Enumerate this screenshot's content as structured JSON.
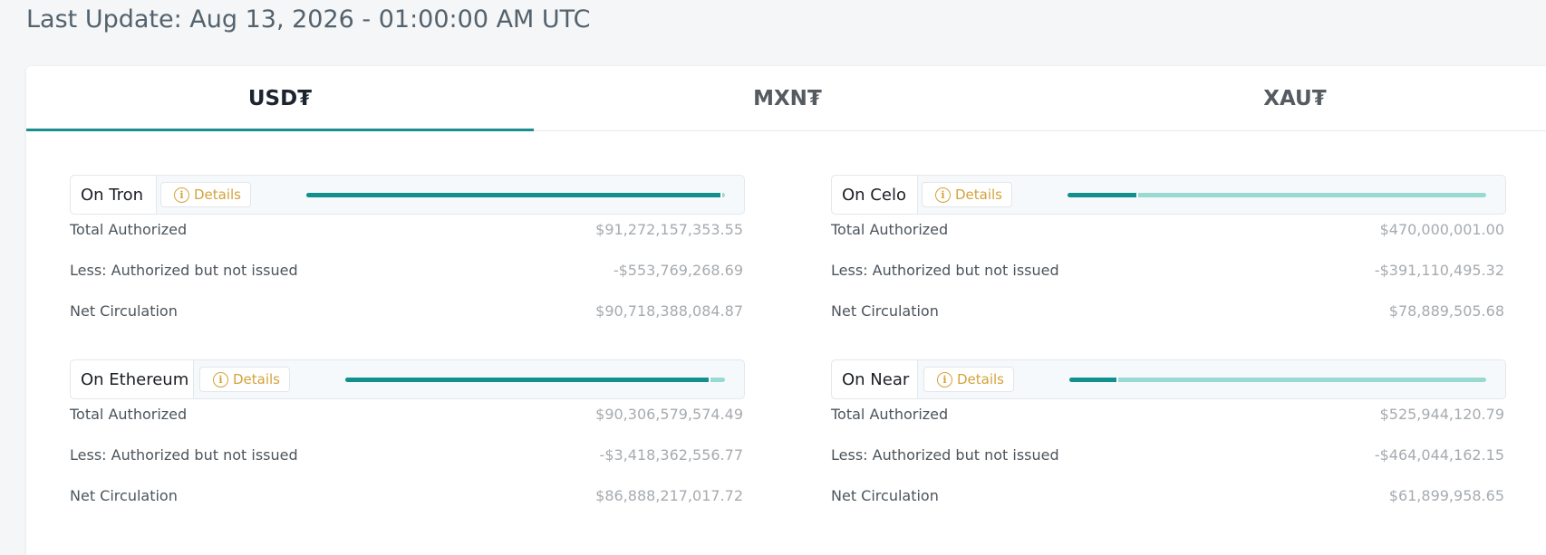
{
  "header": {
    "last_update": "Last Update: Aug 13, 2026 - 01:00:00 AM UTC"
  },
  "tabs": [
    {
      "label": "USD₮",
      "active": true
    },
    {
      "label": "MXN₮",
      "active": false
    },
    {
      "label": "XAU₮",
      "active": false
    }
  ],
  "colors": {
    "accent": "#1a8d8e",
    "bar_fill": "#12908e",
    "bar_track": "#98d9d2",
    "details": "#d4a23a"
  },
  "chains": [
    {
      "name": "On Tron",
      "details_label": "Details",
      "details_icon": "info-icon",
      "issued_fraction": 0.994,
      "rows": [
        {
          "label": "Total Authorized",
          "value": "$91,272,157,353.55"
        },
        {
          "label": "Less: Authorized but not issued",
          "value": "-$553,769,268.69"
        },
        {
          "label": "Net Circulation",
          "value": "$90,718,388,084.87"
        }
      ]
    },
    {
      "name": "On Celo",
      "details_label": "Details",
      "details_icon": "info-icon",
      "issued_fraction": 0.168,
      "rows": [
        {
          "label": "Total Authorized",
          "value": "$470,000,001.00"
        },
        {
          "label": "Less: Authorized but not issued",
          "value": "-$391,110,495.32"
        },
        {
          "label": "Net Circulation",
          "value": "$78,889,505.68"
        }
      ]
    },
    {
      "name": "On Ethereum",
      "details_label": "Details",
      "details_icon": "info-icon",
      "issued_fraction": 0.962,
      "rows": [
        {
          "label": "Total Authorized",
          "value": "$90,306,579,574.49"
        },
        {
          "label": "Less: Authorized but not issued",
          "value": "-$3,418,362,556.77"
        },
        {
          "label": "Net Circulation",
          "value": "$86,888,217,017.72"
        }
      ]
    },
    {
      "name": "On Near",
      "details_label": "Details",
      "details_icon": "info-icon",
      "issued_fraction": 0.118,
      "rows": [
        {
          "label": "Total Authorized",
          "value": "$525,944,120.79"
        },
        {
          "label": "Less: Authorized but not issued",
          "value": "-$464,044,162.15"
        },
        {
          "label": "Net Circulation",
          "value": "$61,899,958.65"
        }
      ]
    }
  ]
}
